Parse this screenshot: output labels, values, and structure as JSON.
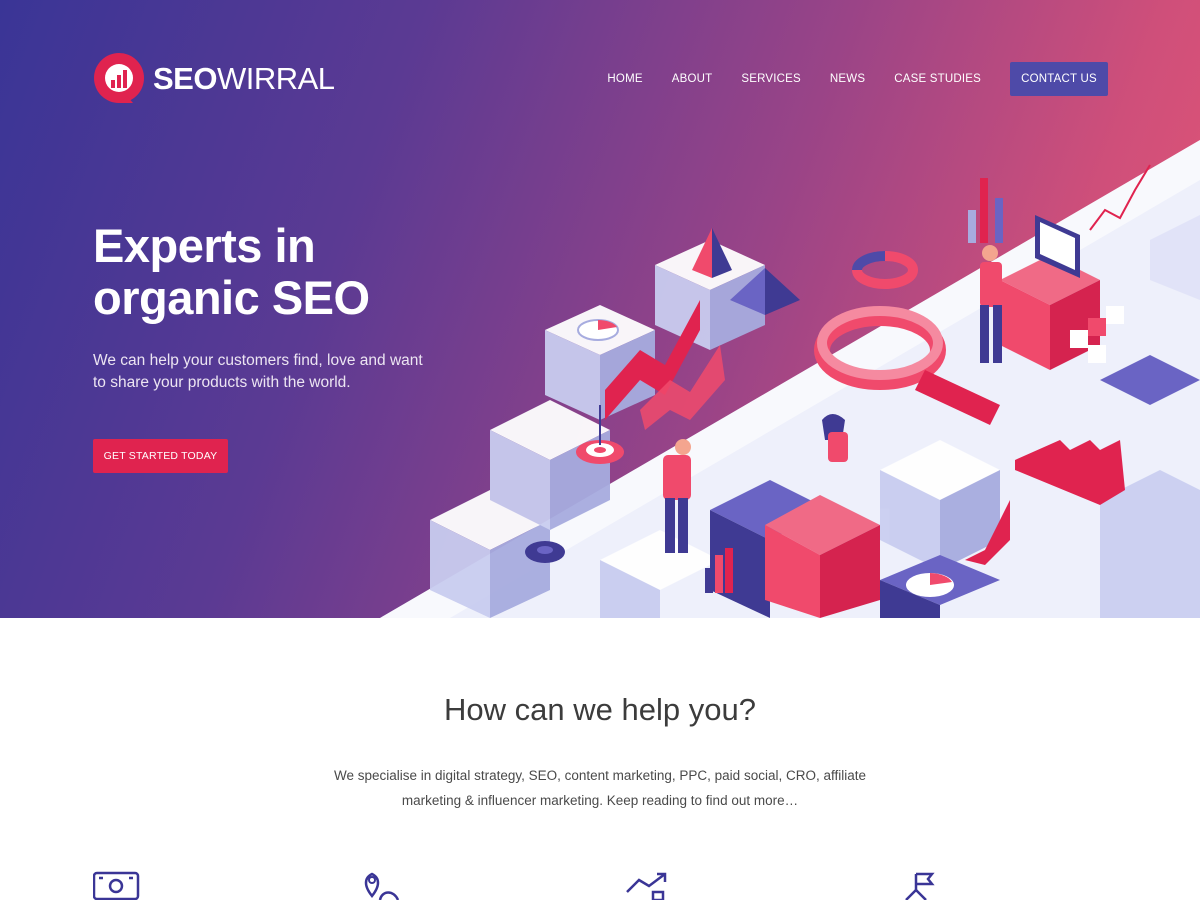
{
  "brand": {
    "name_bold": "SEO",
    "name_light": "WIRRAL"
  },
  "nav": {
    "items": [
      "HOME",
      "ABOUT",
      "SERVICES",
      "NEWS",
      "CASE STUDIES"
    ],
    "contact_label": "CONTACT US"
  },
  "hero": {
    "title": "Experts in organic SEO",
    "subtitle": "We can help your customers find, love and want to share your products with the world.",
    "cta_label": "GET STARTED TODAY"
  },
  "help": {
    "title": "How can we help you?",
    "text": "We specialise in digital strategy, SEO, content marketing, PPC, paid social, CRO, affiliate marketing & influencer marketing. Keep reading to find out more…"
  },
  "services": {
    "icons": [
      "money-icon",
      "location-icon",
      "growth-chart-icon",
      "flag-icon"
    ]
  },
  "colors": {
    "hero_start": "#3a3596",
    "hero_end": "#e85774",
    "cta": "#e0234f",
    "contact_button": "#4e4aa8",
    "icon_stroke": "#3a3596"
  }
}
